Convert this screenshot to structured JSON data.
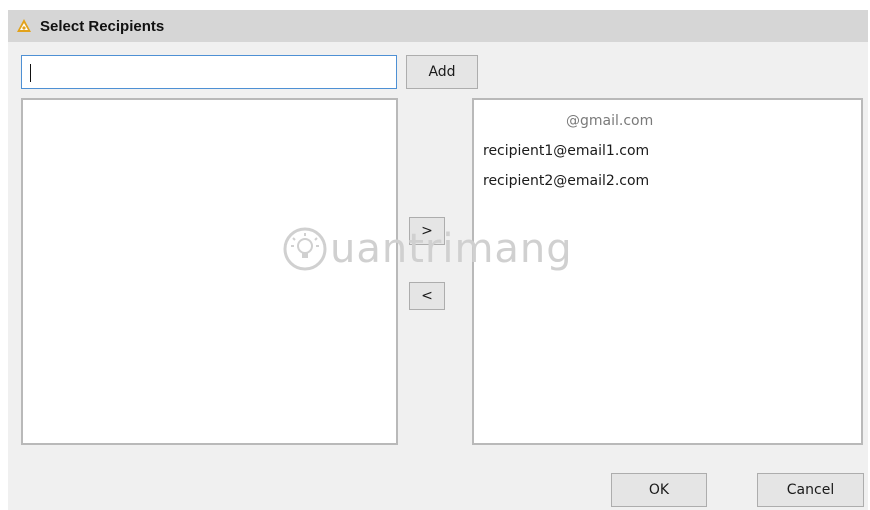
{
  "window": {
    "title": "Select Recipients"
  },
  "input": {
    "value": ""
  },
  "buttons": {
    "add": "Add",
    "move_right": ">",
    "move_left": "<",
    "ok": "OK",
    "cancel": "Cancel"
  },
  "left_list": {
    "items": []
  },
  "right_list": {
    "items": [
      "@gmail.com",
      "recipient1@email1.com",
      "recipient2@email2.com"
    ]
  },
  "watermark": {
    "text": "uantrimang"
  },
  "colors": {
    "accent": "#4e90d4",
    "titlebar": "#d6d6d6",
    "icon": "#e2a21b"
  },
  "icons": {
    "app": "warning-triangle-icon",
    "watermark": "lightbulb-icon"
  }
}
